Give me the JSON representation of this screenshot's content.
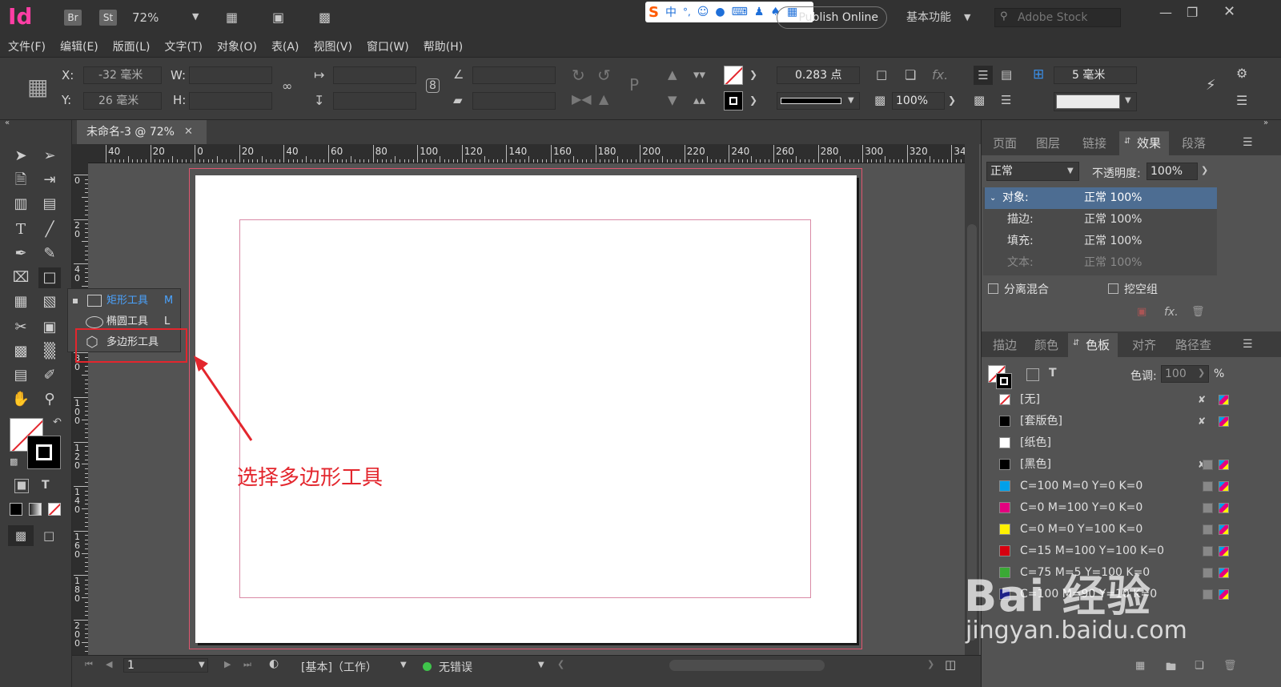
{
  "app": {
    "logo": "Id",
    "bridge": "Br",
    "stock_btn": "St",
    "zoom": "72%",
    "publish_online": "Publish Online",
    "workspace": "基本功能",
    "search_placeholder": "Adobe Stock"
  },
  "menu": [
    "文件(F)",
    "编辑(E)",
    "版面(L)",
    "文字(T)",
    "对象(O)",
    "表(A)",
    "视图(V)",
    "窗口(W)",
    "帮助(H)"
  ],
  "control": {
    "x_label": "X:",
    "x_value": "-32 毫米",
    "y_label": "Y:",
    "y_value": "26 毫米",
    "w_label": "W:",
    "h_label": "H:",
    "stroke_weight": "0.283 点",
    "opacity": "100%",
    "spacing": "5 毫米",
    "fx": "fx."
  },
  "document": {
    "tab_title": "未命名-3 @ 72%",
    "h_ruler": [
      "40",
      "20",
      "0",
      "20",
      "40",
      "60",
      "80",
      "100",
      "120",
      "140",
      "160",
      "180",
      "200",
      "220",
      "240",
      "260",
      "280",
      "300",
      "320",
      "34"
    ],
    "v_ruler": [
      "0",
      "2\n0",
      "4\n0",
      "6\n0",
      "8\n0",
      "1\n0\n0",
      "1\n2\n0",
      "1\n4\n0",
      "1\n6\n0",
      "1\n8\n0",
      "2\n0\n0"
    ]
  },
  "flyout": {
    "items": [
      {
        "label": "矩形工具",
        "key": "M"
      },
      {
        "label": "椭圆工具",
        "key": "L"
      },
      {
        "label": "多边形工具",
        "key": ""
      }
    ]
  },
  "annotation": "选择多边形工具",
  "status": {
    "page": "1",
    "style": "[基本]（工作）",
    "preflight": "无错误"
  },
  "effects_panel": {
    "tabs": [
      "页面",
      "图层",
      "链接",
      "效果",
      "段落"
    ],
    "blend_mode": "正常",
    "opacity_label": "不透明度:",
    "opacity_value": "100%",
    "rows": [
      {
        "name": "对象:",
        "value": "正常 100%"
      },
      {
        "name": "描边:",
        "value": "正常 100%"
      },
      {
        "name": "填充:",
        "value": "正常 100%"
      },
      {
        "name": "文本:",
        "value": "正常 100%"
      }
    ],
    "isolate": "分离混合",
    "knockout": "挖空组"
  },
  "swatches_panel": {
    "tabs": [
      "描边",
      "颜色",
      "色板",
      "对齐",
      "路径查"
    ],
    "tint_label": "色调:",
    "tint_value": "100",
    "tint_unit": "%",
    "swatches": [
      {
        "name": "[无]",
        "color": "none"
      },
      {
        "name": "[套版色]",
        "color": "#000000"
      },
      {
        "name": "[纸色]",
        "color": "#ffffff"
      },
      {
        "name": "[黑色]",
        "color": "#000000"
      },
      {
        "name": "C=100 M=0 Y=0 K=0",
        "color": "#00a0e9"
      },
      {
        "name": "C=0 M=100 Y=0 K=0",
        "color": "#e4007f"
      },
      {
        "name": "C=0 M=0 Y=100 K=0",
        "color": "#fff100"
      },
      {
        "name": "C=15 M=100 Y=100 K=0",
        "color": "#d7000f"
      },
      {
        "name": "C=75 M=5 Y=100 K=0",
        "color": "#3aa935"
      },
      {
        "name": "C=100 M=90 Y=10 K=0",
        "color": "#1d2088"
      }
    ]
  },
  "watermark": {
    "brand": "Bai 经验",
    "url": "jingyan.baidu.com"
  },
  "colors": {
    "accent_red": "#e3262d",
    "selected_row": "#4d6d92",
    "indesign_pink": "#ff3ea5"
  }
}
